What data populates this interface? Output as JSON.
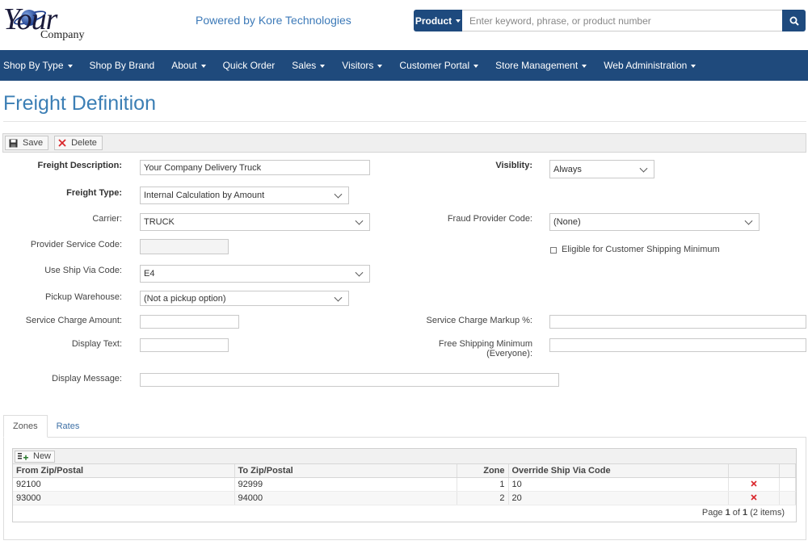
{
  "header": {
    "logo_your": "Your",
    "logo_company": "Company",
    "powered_by": "Powered by Kore Technologies",
    "search_type": "Product",
    "search_placeholder": "Enter keyword, phrase, or product number"
  },
  "nav": [
    {
      "label": "Shop By Type",
      "dropdown": true
    },
    {
      "label": "Shop By Brand",
      "dropdown": false
    },
    {
      "label": "About",
      "dropdown": true
    },
    {
      "label": "Quick Order",
      "dropdown": false
    },
    {
      "label": "Sales",
      "dropdown": true
    },
    {
      "label": "Visitors",
      "dropdown": true
    },
    {
      "label": "Customer Portal",
      "dropdown": true
    },
    {
      "label": "Store Management",
      "dropdown": true
    },
    {
      "label": "Web Administration",
      "dropdown": true
    }
  ],
  "page_title": "Freight Definition",
  "toolbar": {
    "save": "Save",
    "delete": "Delete"
  },
  "form": {
    "freight_description_label": "Freight Description:",
    "freight_description_value": "Your Company Delivery Truck",
    "visibility_label": "Visiblity:",
    "visibility_value": "Always",
    "freight_type_label": "Freight Type:",
    "freight_type_value": "Internal Calculation by Amount",
    "carrier_label": "Carrier:",
    "carrier_value": "TRUCK",
    "fraud_provider_label": "Fraud Provider Code:",
    "fraud_provider_value": "(None)",
    "provider_service_label": "Provider Service Code:",
    "provider_service_value": "",
    "eligible_label": "Eligible for Customer Shipping Minimum",
    "eligible_checked": false,
    "ship_via_label": "Use Ship Via Code:",
    "ship_via_value": "E4",
    "pickup_label": "Pickup Warehouse:",
    "pickup_value": "(Not a pickup option)",
    "service_charge_amount_label": "Service Charge Amount:",
    "service_charge_amount_value": "",
    "service_charge_markup_label": "Service Charge Markup %:",
    "service_charge_markup_value": "",
    "display_text_label": "Display Text:",
    "display_text_value": "",
    "free_shipping_label_1": "Free Shipping Minimum",
    "free_shipping_label_2": "(Everyone):",
    "free_shipping_value": "",
    "display_message_label": "Display Message:",
    "display_message_value": ""
  },
  "tabs": [
    {
      "label": "Zones",
      "active": true
    },
    {
      "label": "Rates",
      "active": false
    }
  ],
  "grid": {
    "new_label": "New",
    "columns": [
      "From Zip/Postal",
      "To Zip/Postal",
      "Zone",
      "Override Ship Via Code"
    ],
    "rows": [
      {
        "from": "92100",
        "to": "92999",
        "zone": "1",
        "override": "10"
      },
      {
        "from": "93000",
        "to": "94000",
        "zone": "2",
        "override": "20"
      }
    ],
    "pager_prefix": "Page ",
    "pager_page": "1",
    "pager_of": " of ",
    "pager_total": "1",
    "pager_items": " (2 items)"
  },
  "colors": {
    "nav_bg": "#1f4a7c",
    "title": "#3c7fb5",
    "delete_red": "#d9262b"
  }
}
